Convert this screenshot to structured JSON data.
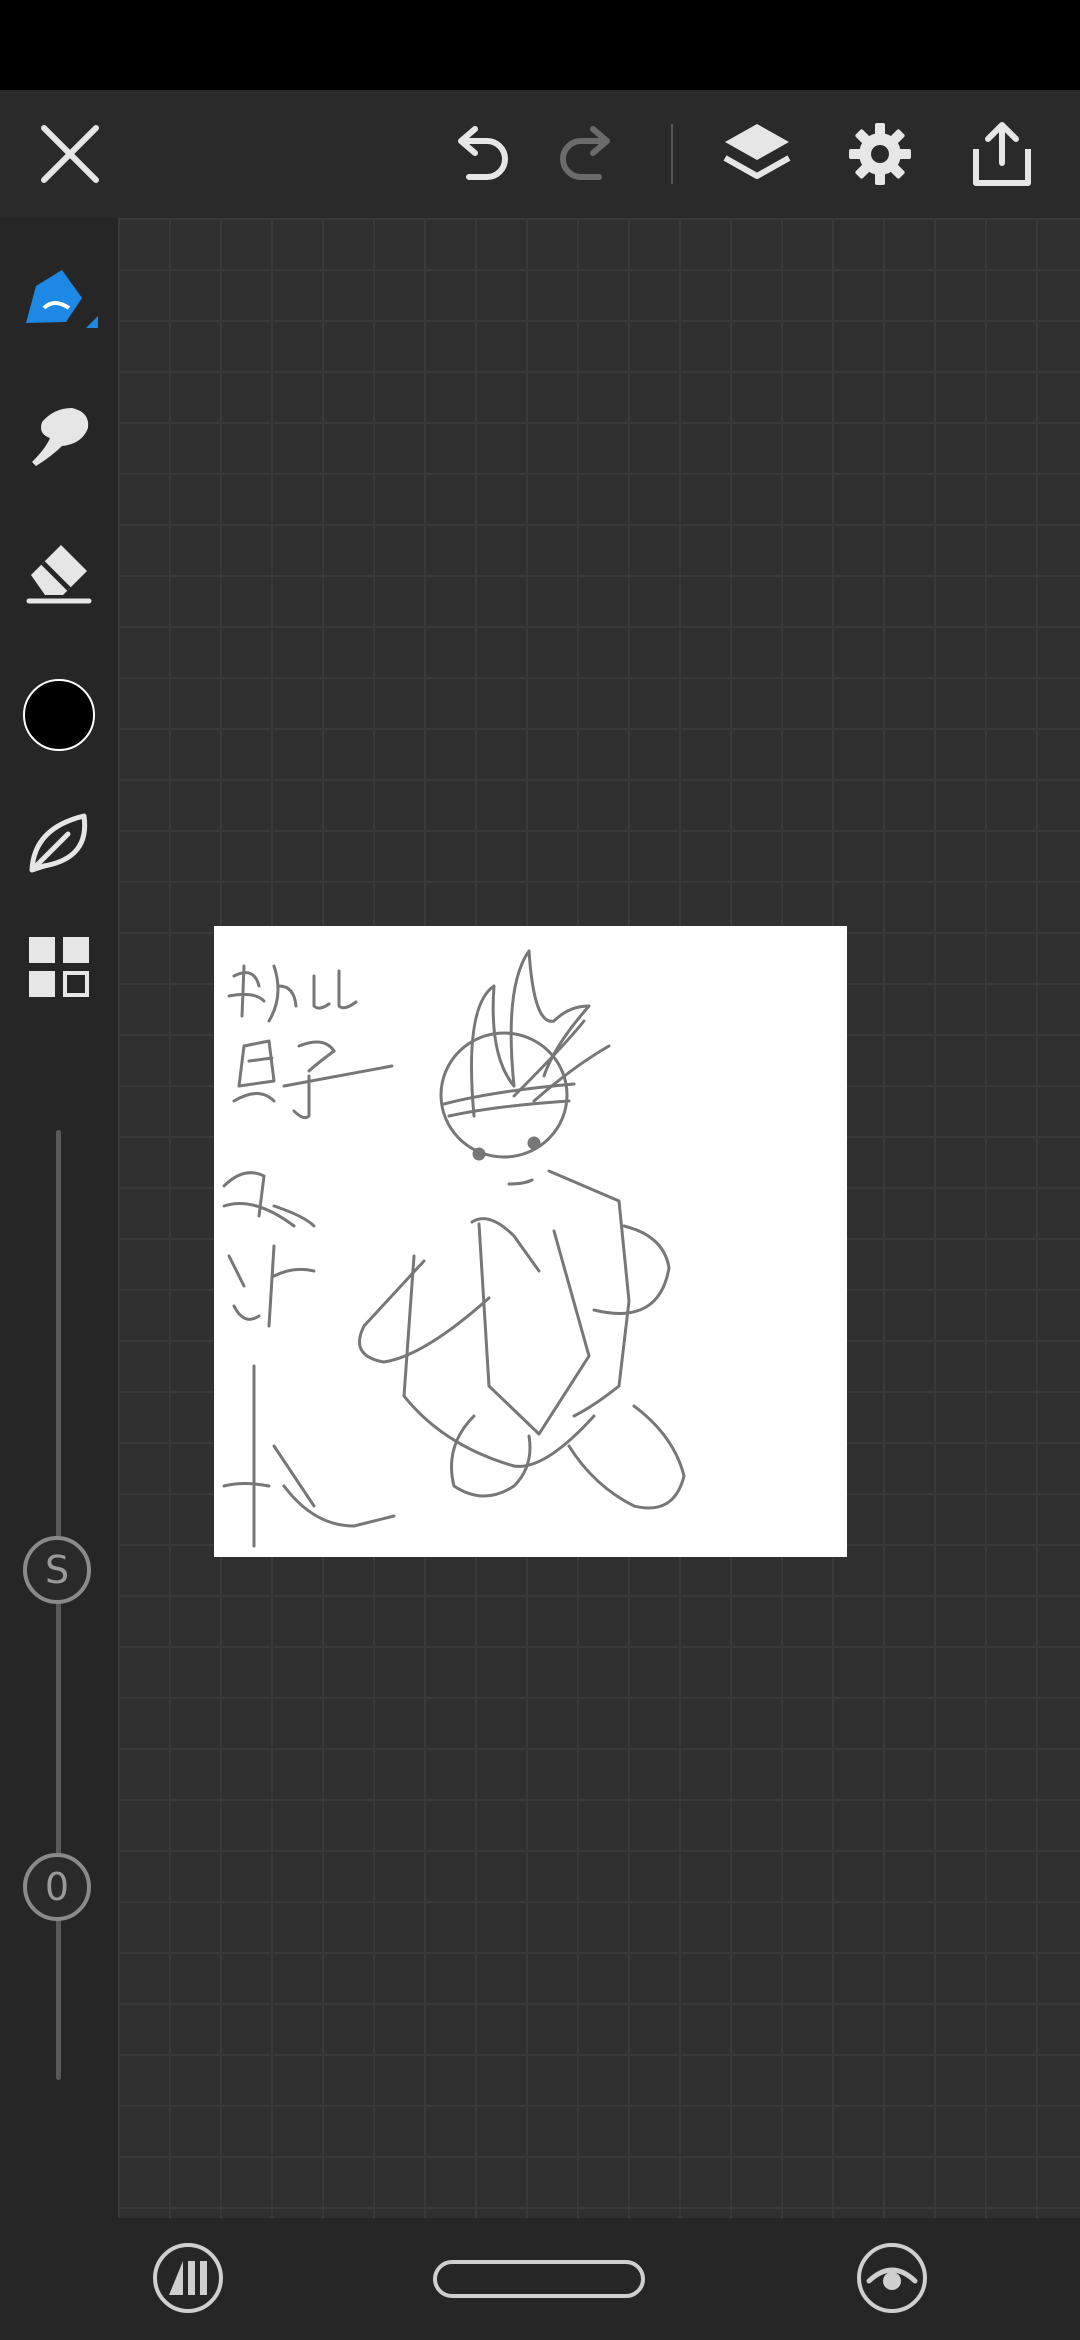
{
  "icons": {
    "close": "close-icon",
    "undo": "undo-icon",
    "redo": "redo-icon",
    "layers": "layers-icon",
    "settings": "gear-icon",
    "export": "share-icon",
    "brush": "brush-icon",
    "smudge": "smudge-icon",
    "eraser": "eraser-icon",
    "color": "color-swatch",
    "brush_library": "leaf-icon",
    "grid": "grid-icon"
  },
  "colors": {
    "accent": "#1e88e5",
    "current_color": "#000000"
  },
  "sliders": {
    "size_label": "S",
    "opacity_label": "0"
  },
  "drawing": {
    "text_lines": [
      "我比",
      "兔子",
      "跑得",
      "快"
    ]
  }
}
